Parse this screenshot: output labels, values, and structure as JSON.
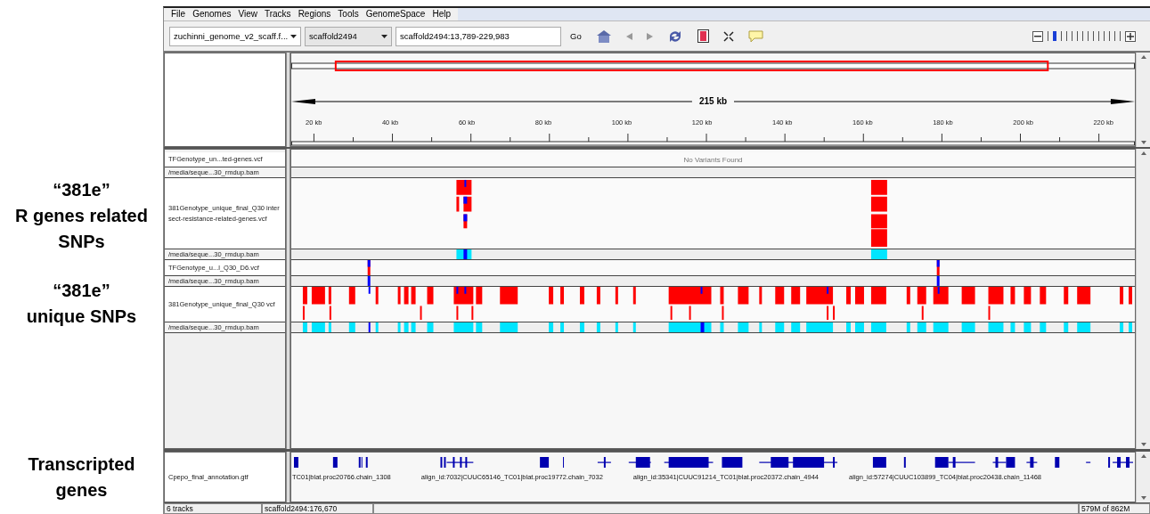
{
  "callouts": [
    {
      "text": "“381e”\nR genes related\nSNPs"
    },
    {
      "text": "“381e”\nunique SNPs"
    },
    {
      "text": "Transcripted\ngenes"
    }
  ],
  "menu": [
    "File",
    "Genomes",
    "View",
    "Tracks",
    "Regions",
    "Tools",
    "GenomeSpace",
    "Help"
  ],
  "toolbar": {
    "genome": "zuchinni_genome_v2_scaff.f...",
    "chromosome": "scaffold2494",
    "locus": "scaffold2494:13,789-229,983",
    "go": "Go"
  },
  "ruler": {
    "span": "215 kb",
    "ticks": [
      "20 kb",
      "40 kb",
      "60 kb",
      "80 kb",
      "100 kb",
      "120 kb",
      "140 kb",
      "160 kb",
      "180 kb",
      "200 kb",
      "220 kb"
    ]
  },
  "tracks": [
    {
      "name": "TFGenotype_un...ted-genes.vcf",
      "kind": "vcf",
      "message": "No Variants Found"
    },
    {
      "name": "/media/seque...30_rmdup.bam",
      "kind": "bam"
    },
    {
      "name": "381Genotype_unique_final_Q30 intersect-resistance-related-genes.vcf",
      "kind": "vcf"
    },
    {
      "name": "/media/seque...30_rmdup.bam",
      "kind": "bam"
    },
    {
      "name": "TFGenotype_u...l_Q30_D6.vcf",
      "kind": "vcf"
    },
    {
      "name": "/media/seque...30_rmdup.bam",
      "kind": "bam"
    },
    {
      "name": "381Genotype_unique_final_Q30 vcf",
      "kind": "vcf"
    },
    {
      "name": "/media/seque...30_rmdup.bam",
      "kind": "bam"
    }
  ],
  "annotation_track": {
    "name": "Cpepo_final_annotation.gtf",
    "features": [
      "TC01|blat.proc20766.chain_1308",
      "align_id:7032|CUUC65146_TC01|blat.proc19772.chain_7032",
      "align_id:35341|CUUC91214_TC01|blat.proc20372.chain_4944",
      "align_id:57274|CUUC103899_TC04|blat.proc20438.chain_11468"
    ]
  },
  "status_bar": {
    "tracks": "6 tracks",
    "position": "scaffold2494:176,670",
    "memory": "579M of 862M"
  }
}
